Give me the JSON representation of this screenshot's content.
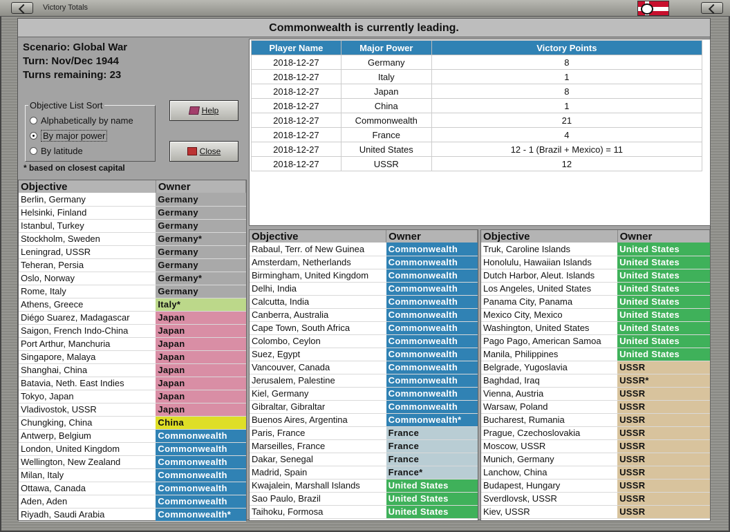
{
  "window": {
    "title": "Victory Totals"
  },
  "header": {
    "text": "Commonwealth is currently leading."
  },
  "info": {
    "scenario": "Scenario: Global War",
    "turn": "Turn: Nov/Dec 1944",
    "remaining": "Turns remaining: 23"
  },
  "sort": {
    "legend": "Objective List Sort",
    "options": [
      "Alphabetically by name",
      "By major power",
      "By latitude"
    ],
    "selected": 1,
    "note": "* based on closest capital"
  },
  "buttons": {
    "help": "Help",
    "close": "Close"
  },
  "victory": {
    "headers": [
      "Player Name",
      "Major Power",
      "Victory Points"
    ],
    "rows": [
      [
        "2018-12-27",
        "Germany",
        "8"
      ],
      [
        "2018-12-27",
        "Italy",
        "1"
      ],
      [
        "2018-12-27",
        "Japan",
        "8"
      ],
      [
        "2018-12-27",
        "China",
        "1"
      ],
      [
        "2018-12-27",
        "Commonwealth",
        "21"
      ],
      [
        "2018-12-27",
        "France",
        "4"
      ],
      [
        "2018-12-27",
        "United States",
        "12 - 1 (Brazil + Mexico) = 11"
      ],
      [
        "2018-12-27",
        "USSR",
        "12"
      ]
    ]
  },
  "colors": {
    "Germany": "#a9a9a9",
    "Italy": "#bcd88a",
    "Japan": "#d98ea5",
    "China": "#dede27",
    "Commonwealth": "#3082b4",
    "France": "#b9cdd4",
    "United States": "#3fb15a",
    "USSR": "#d8c39d"
  },
  "objective_headers": {
    "objective": "Objective",
    "owner": "Owner"
  },
  "objectives": [
    [
      [
        "Berlin, Germany",
        "Germany",
        "Germany"
      ],
      [
        "Helsinki, Finland",
        "Germany",
        "Germany"
      ],
      [
        "Istanbul, Turkey",
        "Germany",
        "Germany"
      ],
      [
        "Stockholm, Sweden",
        "Germany*",
        "Germany"
      ],
      [
        "Leningrad, USSR",
        "Germany",
        "Germany"
      ],
      [
        "Teheran, Persia",
        "Germany",
        "Germany"
      ],
      [
        "Oslo, Norway",
        "Germany*",
        "Germany"
      ],
      [
        "Rome, Italy",
        "Germany",
        "Germany"
      ],
      [
        "Athens, Greece",
        "Italy*",
        "Italy"
      ],
      [
        "Diégo Suarez, Madagascar",
        "Japan",
        "Japan"
      ],
      [
        "Saigon, French Indo-China",
        "Japan",
        "Japan"
      ],
      [
        "Port Arthur, Manchuria",
        "Japan",
        "Japan"
      ],
      [
        "Singapore, Malaya",
        "Japan",
        "Japan"
      ],
      [
        "Shanghai, China",
        "Japan",
        "Japan"
      ],
      [
        "Batavia, Neth. East Indies",
        "Japan",
        "Japan"
      ],
      [
        "Tokyo, Japan",
        "Japan",
        "Japan"
      ],
      [
        "Vladivostok, USSR",
        "Japan",
        "Japan"
      ],
      [
        "Chungking, China",
        "China",
        "China"
      ],
      [
        "Antwerp, Belgium",
        "Commonwealth",
        "Commonwealth"
      ],
      [
        "London, United Kingdom",
        "Commonwealth",
        "Commonwealth"
      ],
      [
        "Wellington, New Zealand",
        "Commonwealth",
        "Commonwealth"
      ],
      [
        "Milan, Italy",
        "Commonwealth",
        "Commonwealth"
      ],
      [
        "Ottawa, Canada",
        "Commonwealth",
        "Commonwealth"
      ],
      [
        "Aden, Aden",
        "Commonwealth",
        "Commonwealth"
      ],
      [
        "Riyadh, Saudi Arabia",
        "Commonwealth*",
        "Commonwealth"
      ]
    ],
    [
      [
        "Rabaul, Terr. of New Guinea",
        "Commonwealth",
        "Commonwealth"
      ],
      [
        "Amsterdam, Netherlands",
        "Commonwealth",
        "Commonwealth"
      ],
      [
        "Birmingham, United Kingdom",
        "Commonwealth",
        "Commonwealth"
      ],
      [
        "Delhi, India",
        "Commonwealth",
        "Commonwealth"
      ],
      [
        "Calcutta, India",
        "Commonwealth",
        "Commonwealth"
      ],
      [
        "Canberra, Australia",
        "Commonwealth",
        "Commonwealth"
      ],
      [
        "Cape Town, South Africa",
        "Commonwealth",
        "Commonwealth"
      ],
      [
        "Colombo, Ceylon",
        "Commonwealth",
        "Commonwealth"
      ],
      [
        "Suez, Egypt",
        "Commonwealth",
        "Commonwealth"
      ],
      [
        "Vancouver, Canada",
        "Commonwealth",
        "Commonwealth"
      ],
      [
        "Jerusalem, Palestine",
        "Commonwealth",
        "Commonwealth"
      ],
      [
        "Kiel, Germany",
        "Commonwealth",
        "Commonwealth"
      ],
      [
        "Gibraltar, Gibraltar",
        "Commonwealth",
        "Commonwealth"
      ],
      [
        "Buenos Aires, Argentina",
        "Commonwealth*",
        "Commonwealth"
      ],
      [
        "Paris, France",
        "France",
        "France"
      ],
      [
        "Marseilles, France",
        "France",
        "France"
      ],
      [
        "Dakar, Senegal",
        "France",
        "France"
      ],
      [
        "Madrid, Spain",
        "France*",
        "France"
      ],
      [
        "Kwajalein, Marshall Islands",
        "United States",
        "United States"
      ],
      [
        "Sao Paulo, Brazil",
        "United States",
        "United States"
      ],
      [
        "Taihoku, Formosa",
        "United States",
        "United States"
      ]
    ],
    [
      [
        "Truk, Caroline Islands",
        "United States",
        "United States"
      ],
      [
        "Honolulu, Hawaiian Islands",
        "United States",
        "United States"
      ],
      [
        "Dutch Harbor, Aleut. Islands",
        "United States",
        "United States"
      ],
      [
        "Los Angeles, United States",
        "United States",
        "United States"
      ],
      [
        "Panama City, Panama",
        "United States",
        "United States"
      ],
      [
        "Mexico City, Mexico",
        "United States",
        "United States"
      ],
      [
        "Washington, United States",
        "United States",
        "United States"
      ],
      [
        "Pago Pago, American Samoa",
        "United States",
        "United States"
      ],
      [
        "Manila, Philippines",
        "United States",
        "United States"
      ],
      [
        "Belgrade, Yugoslavia",
        "USSR",
        "USSR"
      ],
      [
        "Baghdad, Iraq",
        "USSR*",
        "USSR"
      ],
      [
        "Vienna, Austria",
        "USSR",
        "USSR"
      ],
      [
        "Warsaw, Poland",
        "USSR",
        "USSR"
      ],
      [
        "Bucharest, Rumania",
        "USSR",
        "USSR"
      ],
      [
        "Prague, Czechoslovakia",
        "USSR",
        "USSR"
      ],
      [
        "Moscow, USSR",
        "USSR",
        "USSR"
      ],
      [
        "Munich, Germany",
        "USSR",
        "USSR"
      ],
      [
        "Lanchow, China",
        "USSR",
        "USSR"
      ],
      [
        "Budapest, Hungary",
        "USSR",
        "USSR"
      ],
      [
        "Sverdlovsk, USSR",
        "USSR",
        "USSR"
      ],
      [
        "Kiev, USSR",
        "USSR",
        "USSR"
      ]
    ]
  ]
}
